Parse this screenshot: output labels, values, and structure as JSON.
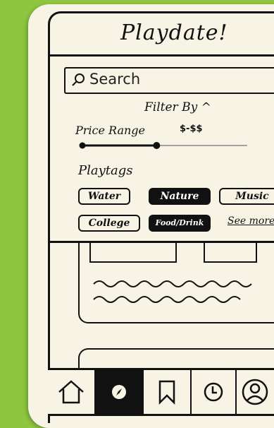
{
  "app": {
    "title": "Playdate!"
  },
  "search": {
    "placeholder": "Search"
  },
  "filter": {
    "label": "Filter By ^"
  },
  "price": {
    "label": "Price Range",
    "range_text": "$-$$",
    "slider_level": 0.45
  },
  "playtags": {
    "label": "Playtags",
    "tags": [
      {
        "label": "Water",
        "active": false
      },
      {
        "label": "Nature",
        "active": true
      },
      {
        "label": "Music",
        "active": false
      },
      {
        "label": "College",
        "active": false
      },
      {
        "label": "Food/Drink",
        "active": true
      }
    ],
    "see_more": "See more"
  },
  "nav": {
    "items": [
      {
        "icon": "home-icon",
        "active": false
      },
      {
        "icon": "compass-icon",
        "active": true
      },
      {
        "icon": "bookmark-icon",
        "active": false
      },
      {
        "icon": "clock-icon",
        "active": false
      },
      {
        "icon": "profile-icon",
        "active": false
      }
    ]
  },
  "colors": {
    "background": "#8ec63f",
    "paper": "#f7f4e6",
    "ink": "#111111"
  }
}
